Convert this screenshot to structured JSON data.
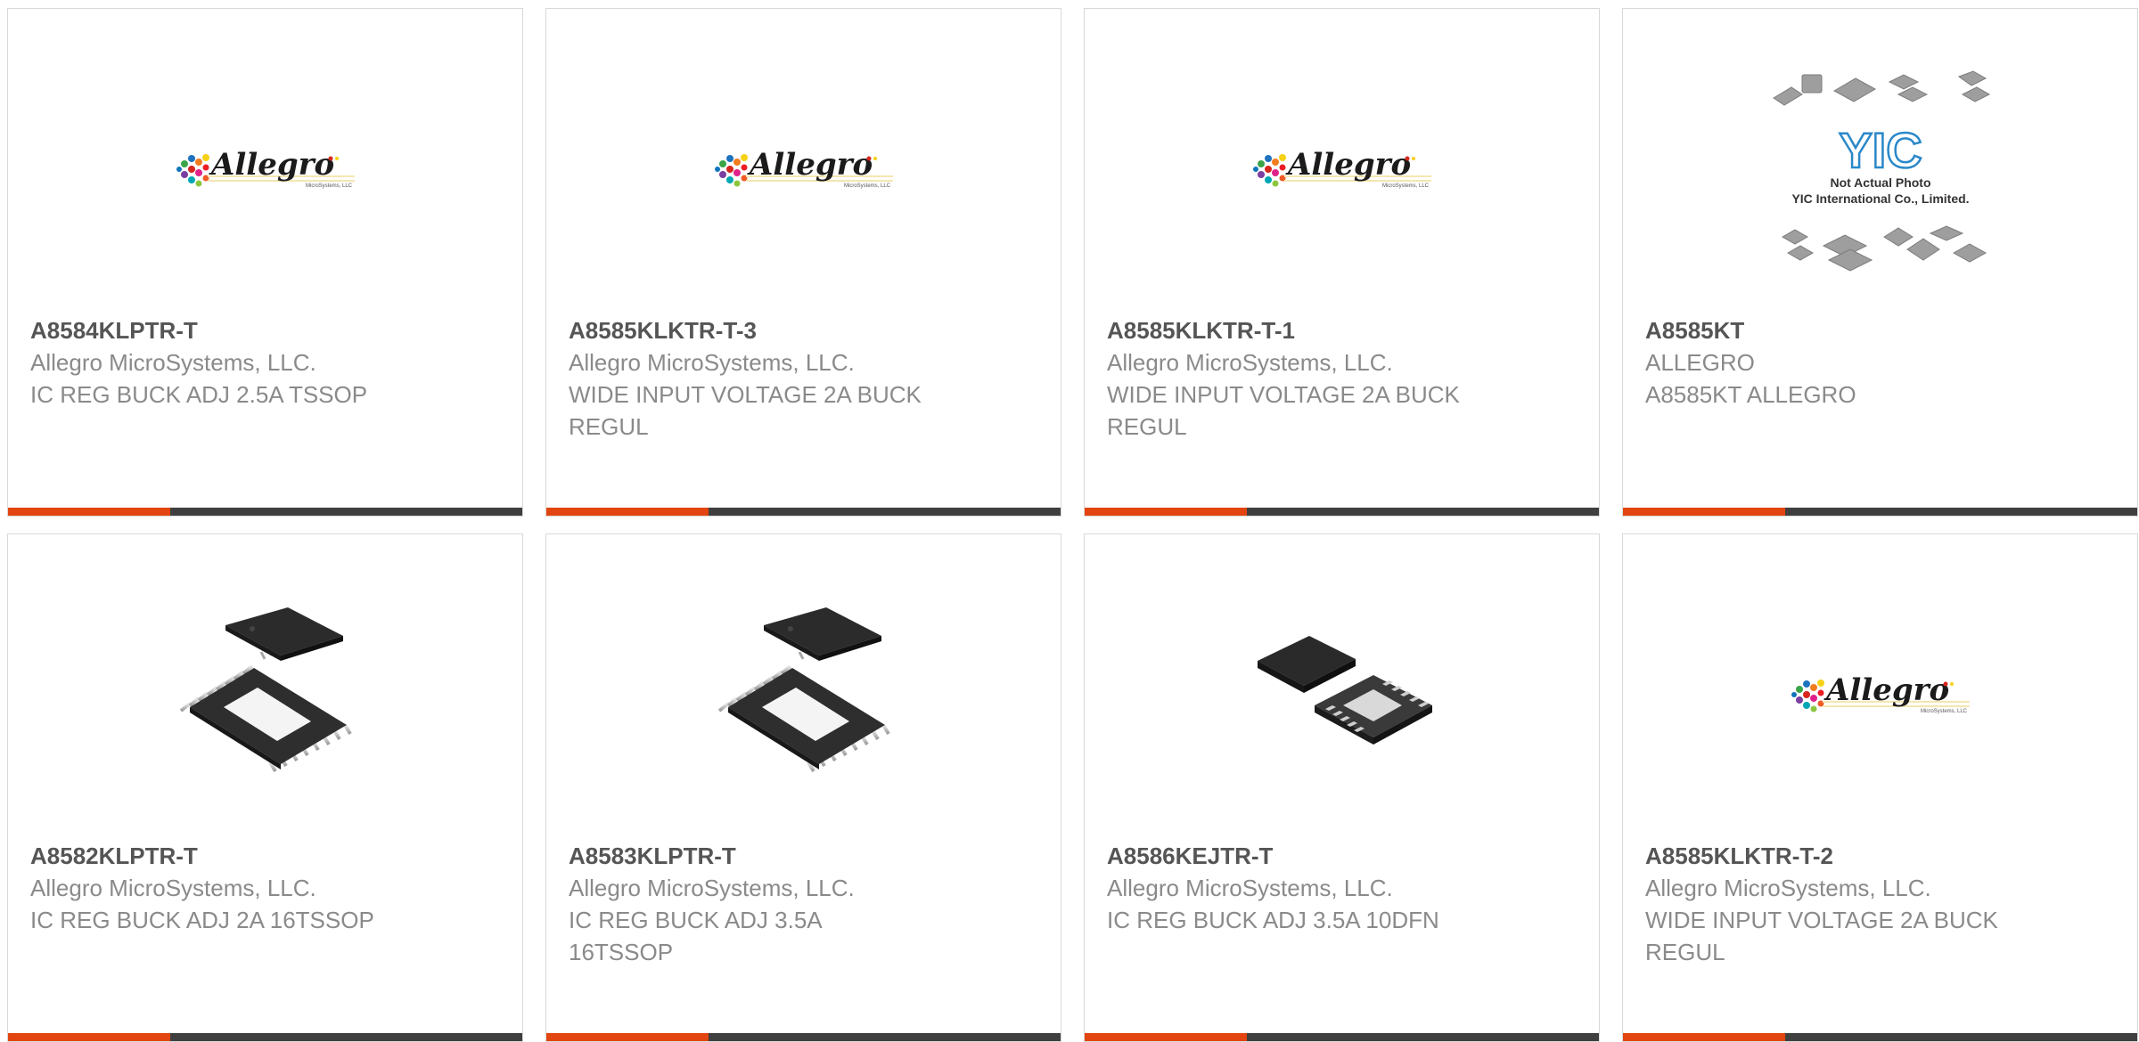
{
  "colors": {
    "accent": "#e2450f",
    "bar": "#3f3f3f",
    "title": "#555555",
    "text": "#8a8a8a"
  },
  "products": [
    {
      "part_number": "A8584KLPTR-T",
      "manufacturer": "Allegro MicroSystems, LLC.",
      "description": "IC REG BUCK ADJ 2.5A TSSOP",
      "image": "allegro-logo"
    },
    {
      "part_number": "A8585KLKTR-T-3",
      "manufacturer": "Allegro MicroSystems, LLC.",
      "description": "WIDE INPUT VOLTAGE 2A BUCK REGUL",
      "image": "allegro-logo"
    },
    {
      "part_number": "A8585KLKTR-T-1",
      "manufacturer": "Allegro MicroSystems, LLC.",
      "description": "WIDE INPUT VOLTAGE 2A BUCK REGUL",
      "image": "allegro-logo"
    },
    {
      "part_number": "A8585KT",
      "manufacturer": "ALLEGRO",
      "description": "A8585KT ALLEGRO",
      "image": "yic-placeholder"
    },
    {
      "part_number": "A8582KLPTR-T",
      "manufacturer": "Allegro MicroSystems, LLC.",
      "description": "IC REG BUCK ADJ 2A 16TSSOP",
      "image": "tssop-chip"
    },
    {
      "part_number": "A8583KLPTR-T",
      "manufacturer": "Allegro MicroSystems, LLC.",
      "description": "IC REG BUCK ADJ 3.5A 16TSSOP",
      "image": "tssop-chip"
    },
    {
      "part_number": "A8586KEJTR-T",
      "manufacturer": "Allegro MicroSystems, LLC.",
      "description": "IC REG BUCK ADJ 3.5A 10DFN",
      "image": "dfn-chip"
    },
    {
      "part_number": "A8585KLKTR-T-2",
      "manufacturer": "Allegro MicroSystems, LLC.",
      "description": "WIDE INPUT VOLTAGE 2A BUCK REGUL",
      "image": "allegro-logo"
    }
  ],
  "logo": {
    "brand": "Allegro",
    "sub": "MicroSystems, LLC"
  },
  "yic": {
    "mark": "YIC",
    "line1": "Not Actual Photo",
    "line2": "YIC International Co., Limited."
  }
}
